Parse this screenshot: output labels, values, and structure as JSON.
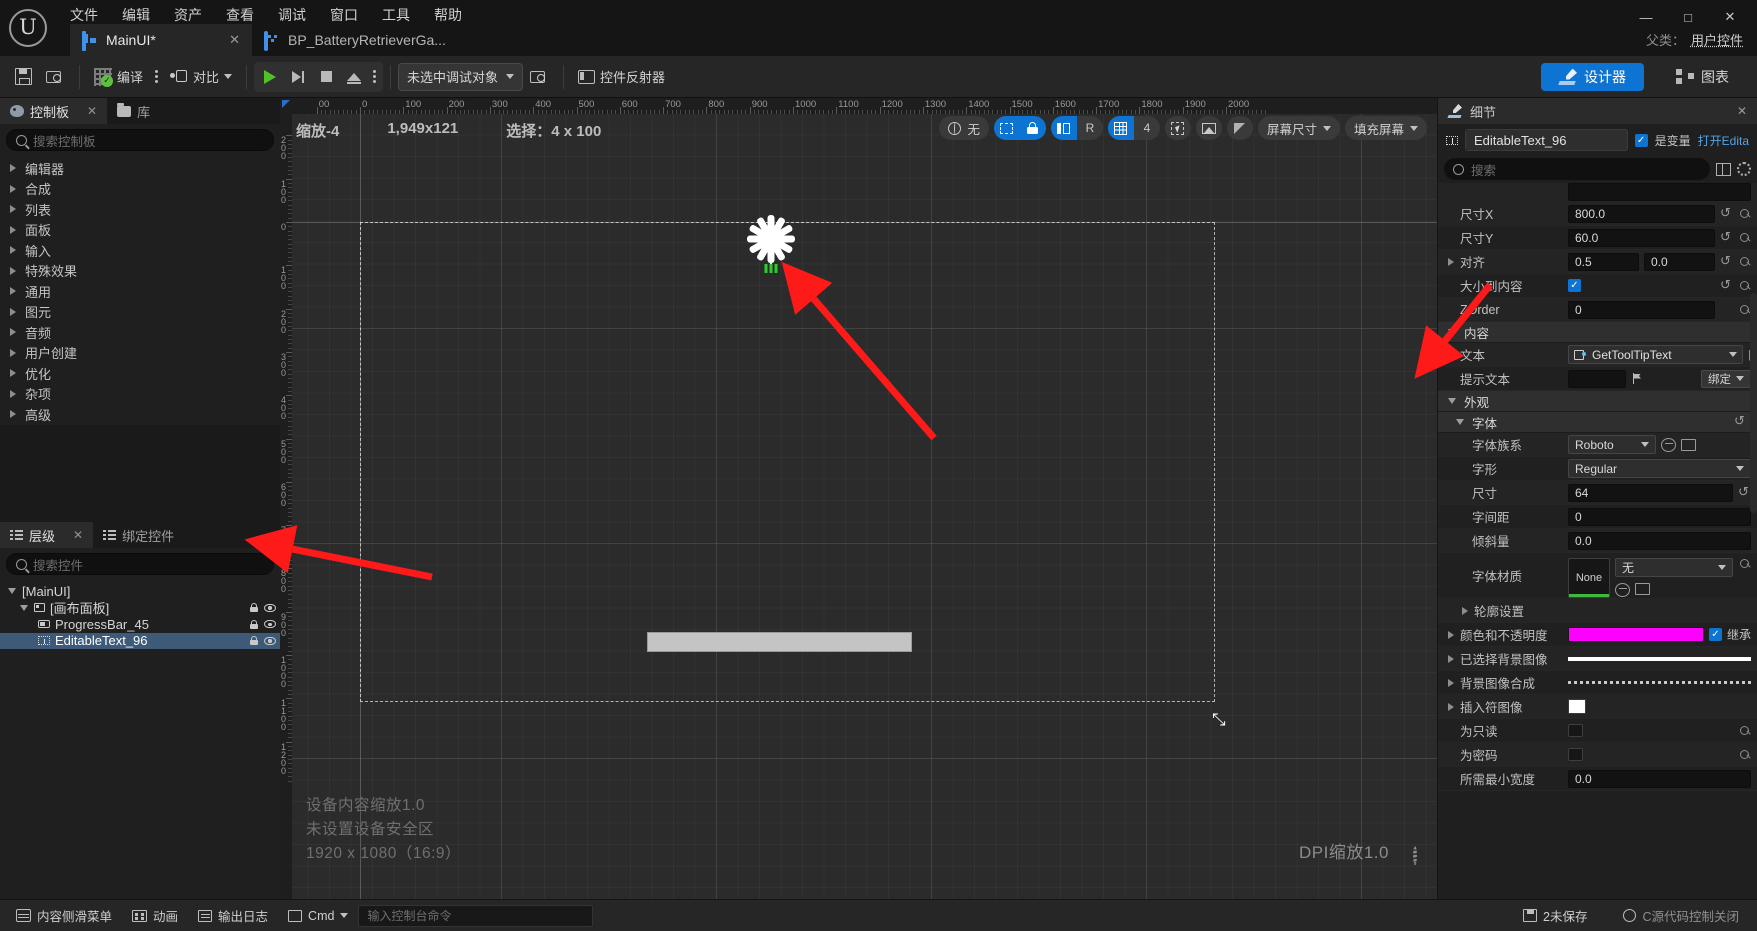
{
  "titlebar": {
    "logo": "U",
    "menus": [
      "文件",
      "编辑",
      "资产",
      "查看",
      "调试",
      "窗口",
      "工具",
      "帮助"
    ],
    "tabs": [
      {
        "label": "MainUI*",
        "icon": "umg-widget-icon",
        "active": true,
        "close": "✕"
      },
      {
        "label": "BP_BatteryRetrieverGa...",
        "icon": "blueprint-icon",
        "active": false
      }
    ],
    "window_controls": {
      "minimize": "—",
      "maximize": "□",
      "close": "✕"
    },
    "parent_class_label": "父类：",
    "parent_class_value": "用户控件"
  },
  "toolbar": {
    "save": "",
    "browse": "",
    "compile": "编译",
    "diff": "对比",
    "debug_object": "未选中调试对象",
    "widget_reflector": "控件反射器",
    "designer": "设计器",
    "graph": "图表"
  },
  "palette": {
    "tabs": [
      {
        "label": "控制板",
        "icon": "palette-icon",
        "active": true,
        "close": "✕"
      },
      {
        "label": "库",
        "icon": "folder-icon",
        "active": false
      }
    ],
    "search_placeholder": "搜索控制板",
    "categories": [
      "编辑器",
      "合成",
      "列表",
      "面板",
      "输入",
      "特殊效果",
      "通用",
      "图元",
      "音频",
      "用户创建",
      "优化",
      "杂项",
      "高级"
    ]
  },
  "hierarchy": {
    "tabs": [
      {
        "label": "层级",
        "icon": "list-icon",
        "active": true,
        "close": "✕"
      },
      {
        "label": "绑定控件",
        "icon": "list-icon",
        "active": false
      }
    ],
    "search_placeholder": "搜索控件",
    "tree": [
      {
        "label": "[MainUI]",
        "depth": 0,
        "expanded": true,
        "icon": "none",
        "selected": false,
        "lock": false,
        "eye": false
      },
      {
        "label": "[画布面板]",
        "depth": 1,
        "expanded": true,
        "icon": "canvas-panel-icon",
        "selected": false,
        "lock": true,
        "eye": true
      },
      {
        "label": "ProgressBar_45",
        "depth": 2,
        "expanded": false,
        "icon": "progress-bar-icon",
        "selected": false,
        "lock": true,
        "eye": true
      },
      {
        "label": "EditableText_96",
        "depth": 2,
        "expanded": false,
        "icon": "editable-text-icon",
        "selected": true,
        "lock": true,
        "eye": true
      }
    ]
  },
  "viewport": {
    "zoom_label": "缩放-4",
    "size_label": "1,949x121",
    "selection_label": "选择：4 x 100",
    "ruler_top_labels": [
      "00",
      "0",
      "100",
      "200",
      "300",
      "400",
      "500",
      "600",
      "700",
      "800",
      "900",
      "1000",
      "1100",
      "1200",
      "1300",
      "1400",
      "1500",
      "1600",
      "1700",
      "1800",
      "1900"
    ],
    "ruler_left_labels": [
      "2",
      "0",
      "0",
      "1",
      "0",
      "0",
      "0",
      "1",
      "0",
      "0",
      "2",
      "0",
      "0",
      "3",
      "0",
      "0",
      "4",
      "0",
      "0",
      "5",
      "0",
      "0",
      "6",
      "0",
      "0",
      "7",
      "0",
      "0",
      "8",
      "0",
      "0",
      "9",
      "0",
      "0",
      "1",
      "0",
      "0",
      "0"
    ],
    "toolbar": {
      "globe_label": "无",
      "selection_outline": "selection-outline-icon",
      "lock_icon": "lock-icon",
      "fill_left": "fill-left-icon",
      "r_label": "R",
      "grid_icon": "grid-icon",
      "grid_size": "4",
      "cursor_icon": "cursor-icon",
      "image_icon": "image-icon",
      "mirror_icon": "mirror-icon",
      "screen_size": "屏幕尺寸",
      "fill_screen": "填充屏幕"
    },
    "overlay": {
      "device_scale": "设备内容缩放1.0",
      "safe_zone": "未设置设备安全区",
      "resolution": "1920 x 1080（16:9）",
      "dpi_scale": "DPI缩放1.0"
    }
  },
  "details": {
    "tab_label": "细节",
    "tab_close": "✕",
    "object_name": "EditableText_96",
    "is_variable_label": "是变量",
    "is_variable_checked": true,
    "open_edit_label": "打开Edita",
    "search_placeholder": "搜索",
    "properties": [
      {
        "kind": "prop",
        "label": "尺寸X",
        "value": "800.0",
        "control": "input",
        "reset": true,
        "pin": true
      },
      {
        "kind": "prop",
        "label": "尺寸Y",
        "value": "60.0",
        "control": "input",
        "reset": true,
        "pin": true
      },
      {
        "kind": "prop",
        "label": "对齐",
        "value": "0.5",
        "value2": "0.0",
        "control": "input2",
        "expandable": true,
        "reset": true,
        "pin": true
      },
      {
        "kind": "prop",
        "label": "大小到内容",
        "value": "",
        "control": "checkbox",
        "checked": true,
        "reset": true,
        "pin": true
      },
      {
        "kind": "prop",
        "label": "ZOrder",
        "value": "0",
        "control": "input",
        "reset": false,
        "pin": true
      },
      {
        "kind": "section",
        "label": "内容",
        "expanded": true
      },
      {
        "kind": "prop",
        "label": "文本",
        "value": "GetToolTipText",
        "control": "function-binding"
      },
      {
        "kind": "prop",
        "label": "提示文本",
        "value": "",
        "control": "text-bind",
        "bind_label": "绑定"
      },
      {
        "kind": "section",
        "label": "外观",
        "expanded": true
      },
      {
        "kind": "section",
        "label": "字体",
        "expanded": true,
        "reset": true
      },
      {
        "kind": "prop",
        "label": "字体族系",
        "value": "Roboto",
        "control": "select",
        "indent": true
      },
      {
        "kind": "prop",
        "label": "字形",
        "value": "Regular",
        "control": "select",
        "indent": true
      },
      {
        "kind": "prop",
        "label": "尺寸",
        "value": "64",
        "control": "input",
        "indent": true,
        "reset": true
      },
      {
        "kind": "prop",
        "label": "字间距",
        "value": "0",
        "control": "input",
        "indent": true
      },
      {
        "kind": "prop",
        "label": "倾斜量",
        "value": "0.0",
        "control": "input",
        "indent": true
      },
      {
        "kind": "prop",
        "label": "字体材质",
        "value": "None",
        "value2": "无",
        "control": "material",
        "indent": true,
        "pin": true
      },
      {
        "kind": "prop",
        "label": "轮廓设置",
        "value": "",
        "control": "expand",
        "indent": true,
        "expandable": true
      },
      {
        "kind": "prop",
        "label": "颜色和不透明度",
        "value": "",
        "control": "color",
        "color": "#ff00ff",
        "expandable": true,
        "inherit_label": "继承",
        "inherit_checked": true
      },
      {
        "kind": "prop",
        "label": "已选择背景图像",
        "value": "",
        "control": "whitebar",
        "expandable": true
      },
      {
        "kind": "prop",
        "label": "背景图像合成",
        "value": "",
        "control": "dottedbar",
        "expandable": true
      },
      {
        "kind": "prop",
        "label": "插入符图像",
        "value": "",
        "control": "swatch-white",
        "expandable": true
      },
      {
        "kind": "prop",
        "label": "为只读",
        "value": "",
        "control": "checkbox",
        "checked": false,
        "pin": true
      },
      {
        "kind": "prop",
        "label": "为密码",
        "value": "",
        "control": "checkbox",
        "checked": false,
        "pin": true
      },
      {
        "kind": "prop",
        "label": "所需最小宽度",
        "value": "0.0",
        "control": "input"
      }
    ]
  },
  "statusbar": {
    "items": [
      {
        "label": "内容侧滑菜单",
        "icon": "drawer-icon"
      },
      {
        "label": "动画",
        "icon": "film-icon"
      },
      {
        "label": "输出日志",
        "icon": "output-log-icon"
      },
      {
        "label": "Cmd",
        "icon": "cmd-icon",
        "caret": true
      }
    ],
    "cmd_placeholder": "输入控制台命令",
    "right_items": [
      {
        "label": "2未保存",
        "icon": "save-icon"
      },
      {
        "label": "C源代码控制关闭",
        "icon": "source-control-icon"
      }
    ]
  },
  "annotations": {
    "arrow_color": "#ff1a1a",
    "arrow_count": 2
  }
}
